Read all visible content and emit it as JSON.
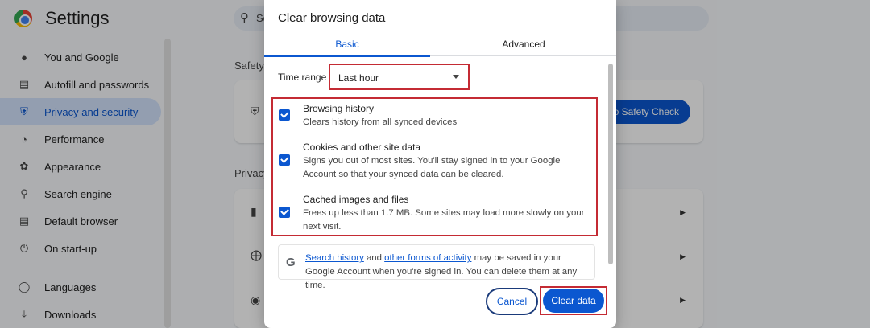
{
  "app": {
    "title": "Settings",
    "search_placeholder": "Se"
  },
  "sidebar": {
    "items": [
      {
        "label": "You and Google",
        "icon": "person-icon"
      },
      {
        "label": "Autofill and passwords",
        "icon": "clipboard-icon"
      },
      {
        "label": "Privacy and security",
        "icon": "shield-icon",
        "active": true
      },
      {
        "label": "Performance",
        "icon": "speedometer-icon"
      },
      {
        "label": "Appearance",
        "icon": "palette-icon"
      },
      {
        "label": "Search engine",
        "icon": "search-icon"
      },
      {
        "label": "Default browser",
        "icon": "browser-icon"
      },
      {
        "label": "On start-up",
        "icon": "power-icon"
      },
      {
        "label": "Languages",
        "icon": "globe-icon"
      },
      {
        "label": "Downloads",
        "icon": "download-icon"
      }
    ]
  },
  "background": {
    "safety_label": "Safety",
    "safety_button": "to Safety Check",
    "privacy_label": "Privacy"
  },
  "dialog": {
    "title": "Clear browsing data",
    "tabs": {
      "basic": "Basic",
      "advanced": "Advanced"
    },
    "time_range_label": "Time range",
    "time_range_value": "Last hour",
    "options": [
      {
        "title": "Browsing history",
        "desc": "Clears history from all synced devices",
        "checked": true
      },
      {
        "title": "Cookies and other site data",
        "desc": "Signs you out of most sites. You'll stay signed in to your Google Account so that your synced data can be cleared.",
        "checked": true
      },
      {
        "title": "Cached images and files",
        "desc": "Frees up less than 1.7 MB. Some sites may load more slowly on your next visit.",
        "checked": true
      }
    ],
    "google_notice": {
      "link1": "Search history",
      "and": " and ",
      "link2": "other forms of activity",
      "rest": " may be saved in your Google Account when you're signed in. You can delete them at any time."
    },
    "cancel_label": "Cancel",
    "clear_label": "Clear data"
  },
  "colors": {
    "accent": "#0b57d0",
    "highlight_border": "#c42b34",
    "active_nav_bg": "#d3e3fd"
  }
}
